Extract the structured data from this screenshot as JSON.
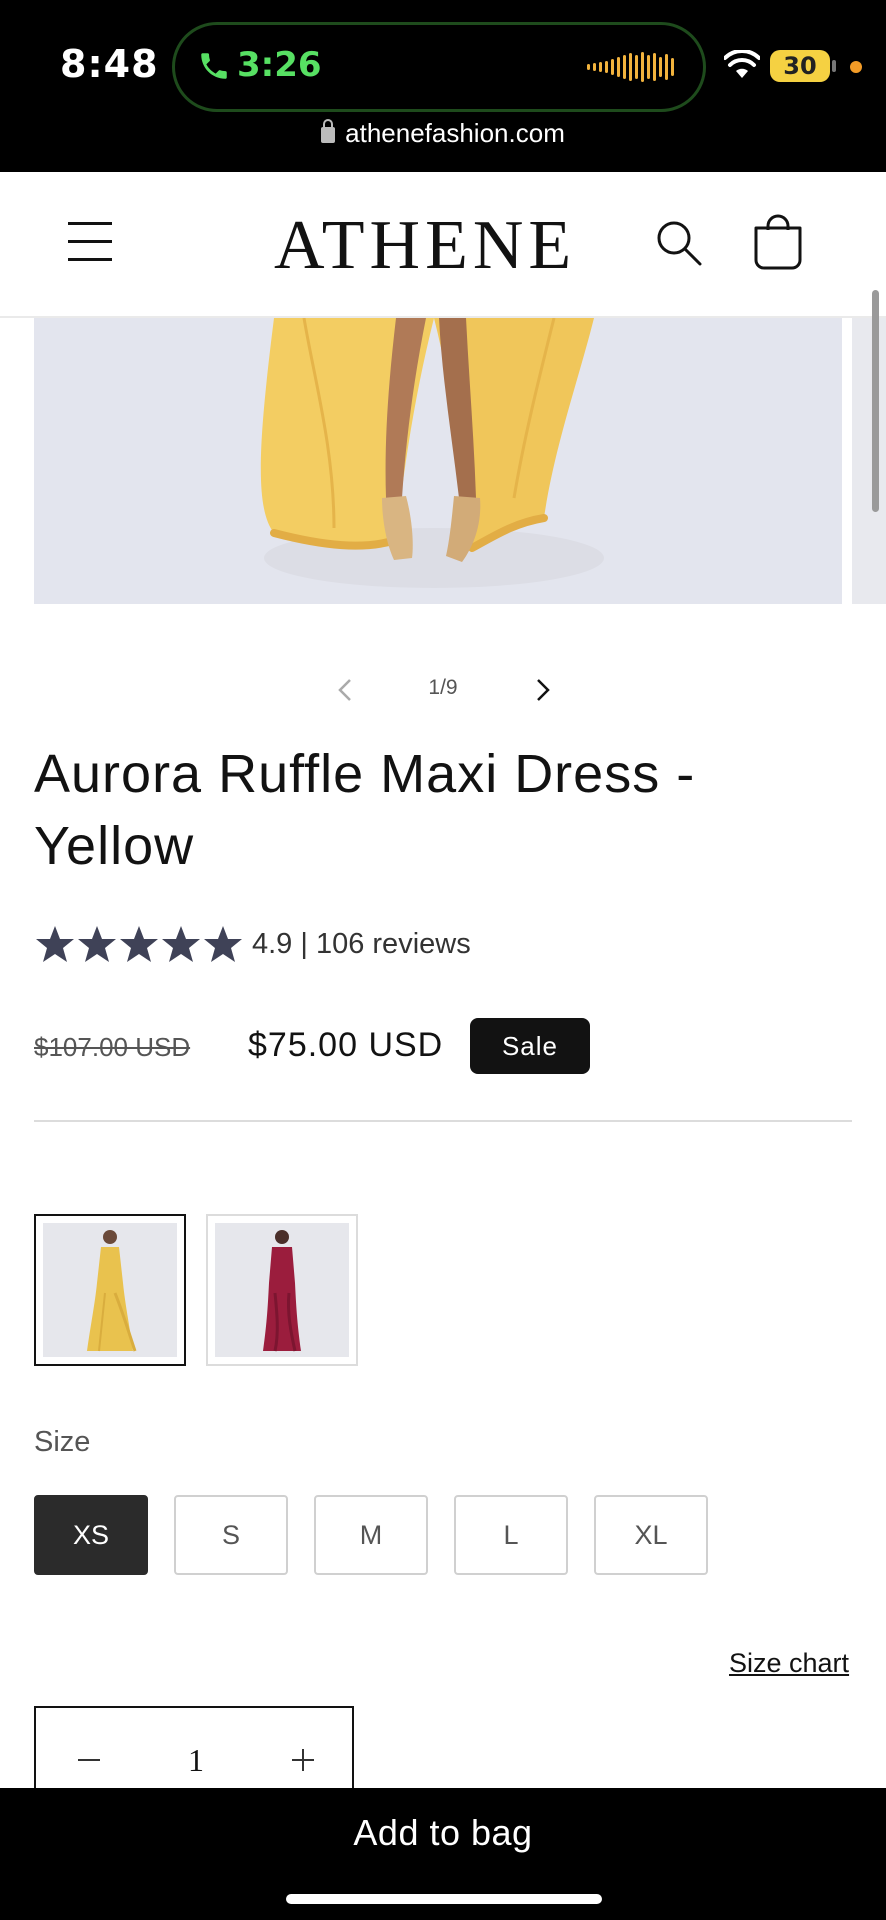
{
  "status_bar": {
    "time": "8:48",
    "call_duration": "3:26",
    "battery": "30",
    "url": "athenefashion.com"
  },
  "header": {
    "logo": "ATHENE",
    "icons": [
      "menu-icon",
      "search-icon",
      "cart-icon"
    ]
  },
  "gallery": {
    "counter": "1/9"
  },
  "product": {
    "title": "Aurora Ruffle Maxi Dress - Yellow",
    "rating_text": "4.9 | 106 reviews",
    "stars": 5,
    "old_price": "$107.00 USD",
    "new_price": "$75.00 USD",
    "sale_badge": "Sale"
  },
  "colors": {
    "swatches": [
      {
        "name": "yellow",
        "color": "#e9c24e",
        "selected": true
      },
      {
        "name": "burgundy",
        "color": "#9b1d3d",
        "selected": false
      }
    ]
  },
  "size": {
    "label": "Size",
    "options": [
      "XS",
      "S",
      "M",
      "L",
      "XL"
    ],
    "selected": "XS",
    "chart_link": "Size chart"
  },
  "quantity": {
    "value": "1"
  },
  "cta": {
    "add_to_bag": "Add to bag"
  },
  "theme": {
    "accent": "#121212",
    "star_color": "#3f4257",
    "call_green": "#57e063"
  }
}
